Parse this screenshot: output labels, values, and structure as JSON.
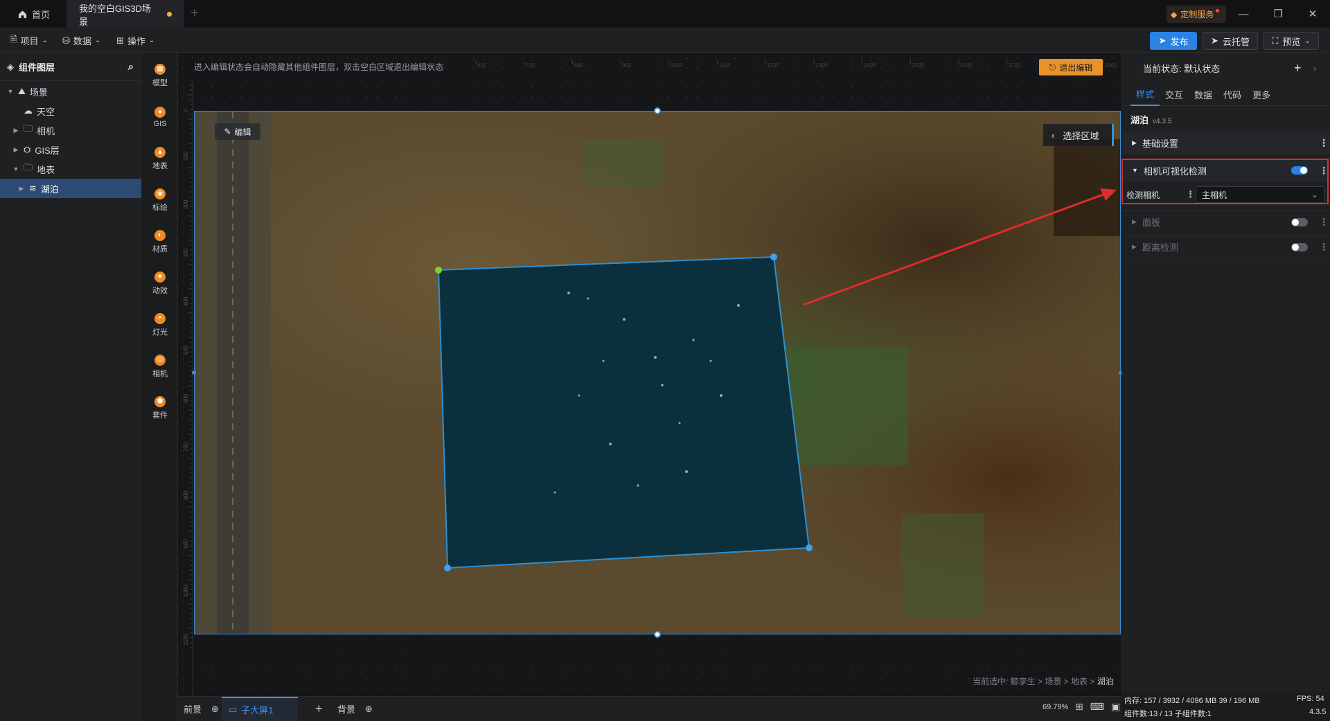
{
  "titlebar": {
    "home_tab": "首页",
    "scene_tab": "我的空白GIS3D场景",
    "add_tab": "+",
    "custom_service": "定制服务"
  },
  "toolbar": {
    "menus": [
      "项目",
      "数据",
      "操作"
    ],
    "publish": "发布",
    "cloud_host": "云托管",
    "preview": "预览"
  },
  "layers": {
    "title": "组件图层",
    "items": [
      {
        "label": "场景",
        "depth": 0,
        "caret": "▼",
        "icon": "scene-icon"
      },
      {
        "label": "天空",
        "depth": 1,
        "caret": "",
        "icon": "sky-icon"
      },
      {
        "label": "相机",
        "depth": 1,
        "caret": "▶",
        "icon": "folder-icon"
      },
      {
        "label": "GIS层",
        "depth": 1,
        "caret": "▶",
        "icon": "gis-layer-icon"
      },
      {
        "label": "地表",
        "depth": 1,
        "caret": "▼",
        "icon": "folder-icon"
      },
      {
        "label": "湖泊",
        "depth": 2,
        "caret": "▶",
        "icon": "lake-icon",
        "selected": true
      }
    ]
  },
  "components": [
    "模型",
    "GIS",
    "地表",
    "标绘",
    "材质",
    "动效",
    "灯光",
    "相机",
    "套件"
  ],
  "canvas": {
    "hint": "进入编辑状态会自动隐藏其他组件图层，双击空白区域退出编辑状态",
    "exit_edit": "退出编辑",
    "edit_chip": "编辑",
    "select_region": "选择区域",
    "breadcrumb_prefix": "当前选中: 鲸孪生 > 场景 > 地表 >",
    "breadcrumb_current": "湖泊",
    "ruler_top": [
      "600",
      "700",
      "800",
      "900",
      "1000",
      "1100",
      "1200",
      "1300",
      "1400",
      "1500",
      "1600",
      "1700",
      "1800",
      "1900"
    ],
    "ruler_left": [
      "0",
      "100",
      "200",
      "300",
      "400",
      "500",
      "600",
      "700",
      "800",
      "900",
      "1000",
      "1100"
    ]
  },
  "bottom": {
    "front": "前景",
    "subscreen": "子大屏1",
    "add": "+",
    "background": "背景",
    "zoom": "69.79%"
  },
  "right": {
    "state_label": "当前状态: 默认状态",
    "tabs": [
      "样式",
      "交互",
      "数据",
      "代码",
      "更多"
    ],
    "component_name": "湖泊",
    "component_version": "v4.3.5",
    "sections": {
      "basic": "基础设置",
      "camera_detect": "相机可视化检测",
      "detect_camera_label": "检测相机",
      "detect_camera_value": "主相机",
      "panel": "面板",
      "distance": "距离检测"
    },
    "toggles": {
      "camera_detect": true,
      "panel": false,
      "distance": false
    }
  },
  "status": {
    "memory": "内存: 157 / 3932 / 4096 MB  39 / 196 MB",
    "fps": "FPS: 54",
    "components": "组件数:13 / 13  子组件数:1",
    "version": "4.3.5"
  },
  "colors": {
    "accent": "#2a82e4",
    "warning": "#e7922a",
    "highlight": "#e02b2b",
    "lake": "#0a2d3a"
  }
}
